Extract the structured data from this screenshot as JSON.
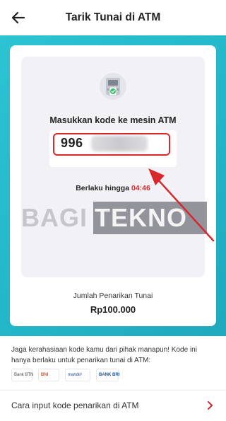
{
  "header": {
    "title": "Tarik Tunai di ATM",
    "back_icon": "arrow-left-icon"
  },
  "colors": {
    "background_teal": "#2cc3d3",
    "highlight_red": "#d8282c",
    "countdown_red": "#d8282c"
  },
  "card": {
    "atm_icon": "atm-machine-icon",
    "instruction": "Masukkan kode ke mesin ATM",
    "code_visible": "996",
    "valid_label": "Berlaku hingga ",
    "countdown": "04:46",
    "amount_label": "Jumlah Penarikan Tunai",
    "amount_value": "Rp100.000"
  },
  "watermark": {
    "left": "BAGI",
    "right": "TEKNO"
  },
  "notice": {
    "text": "Jaga kerahasiaan kode kamu dari pihak manapun! Kode ini hanya berlaku untuk penarikan tunai di ATM:"
  },
  "banks": [
    "Bank BTN",
    "BNI",
    "mandiri",
    "BANK BRI"
  ],
  "footer": {
    "label": "Cara input kode penarikan di ATM",
    "chevron_icon": "chevron-right-icon"
  }
}
